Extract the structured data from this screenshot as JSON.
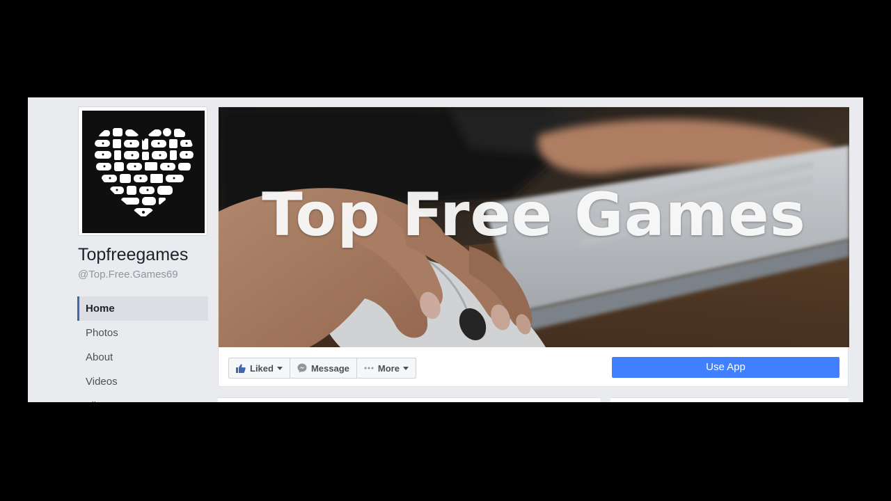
{
  "page": {
    "name": "Topfreegames",
    "handle": "@Top.Free.Games69"
  },
  "nav": {
    "items": [
      {
        "label": "Home",
        "active": true
      },
      {
        "label": "Photos",
        "active": false
      },
      {
        "label": "About",
        "active": false
      },
      {
        "label": "Videos",
        "active": false
      },
      {
        "label": "Likes",
        "active": false
      }
    ]
  },
  "cover": {
    "title": "Top Free Games"
  },
  "actions": {
    "liked_label": "Liked",
    "message_label": "Message",
    "more_label": "More",
    "use_app_label": "Use App"
  },
  "icons": {
    "liked": "thumbs-up-icon",
    "message": "messenger-icon",
    "more": "ellipsis-icon",
    "caret": "caret-down-icon"
  },
  "colors": {
    "accent": "#4080ff",
    "nav_active_border": "#4267b2",
    "like_blue": "#4267b2",
    "background": "#e9ebee"
  }
}
